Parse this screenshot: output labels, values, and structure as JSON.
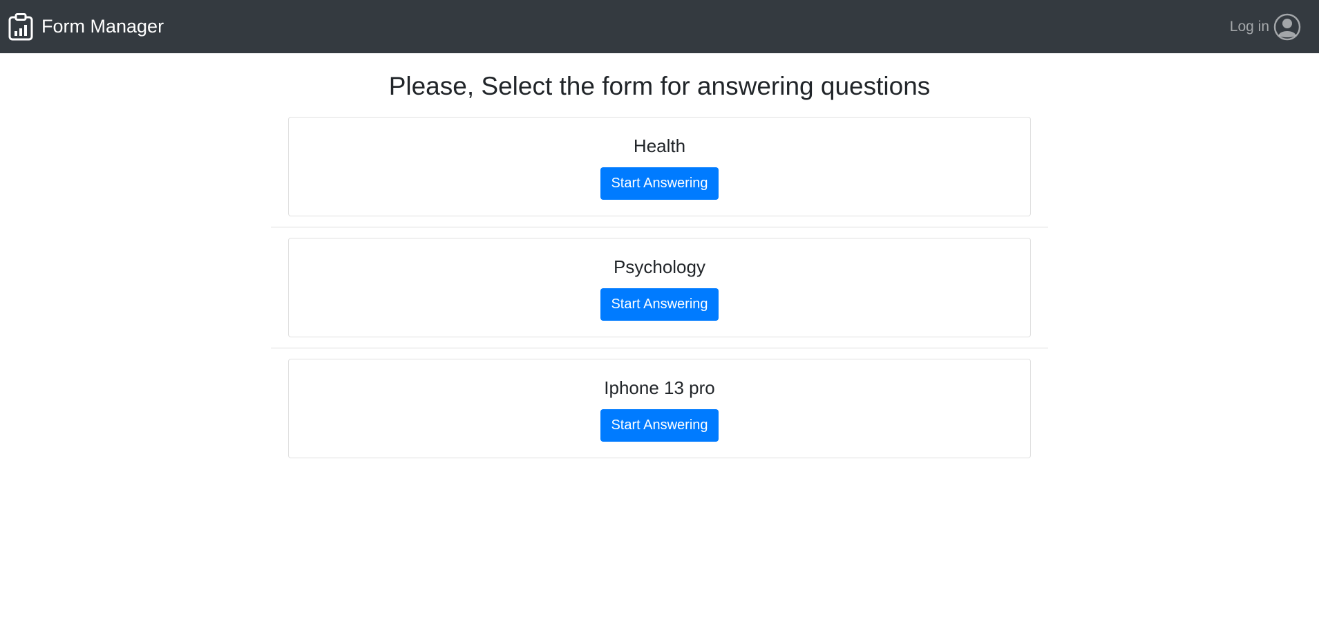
{
  "navbar": {
    "brand": "Form Manager",
    "brand_icon": "clipboard-chart-icon",
    "login_label": "Log in",
    "login_icon": "user-circle-icon",
    "background": "#343a40"
  },
  "main": {
    "title": "Please, Select the form for answering questions"
  },
  "forms": [
    {
      "name": "Health",
      "button": "Start Answering"
    },
    {
      "name": "Psychology",
      "button": "Start Answering"
    },
    {
      "name": "Iphone 13 pro",
      "button": "Start Answering"
    }
  ],
  "colors": {
    "primary": "#007bff",
    "navbar": "#343a40",
    "text": "#212529"
  }
}
